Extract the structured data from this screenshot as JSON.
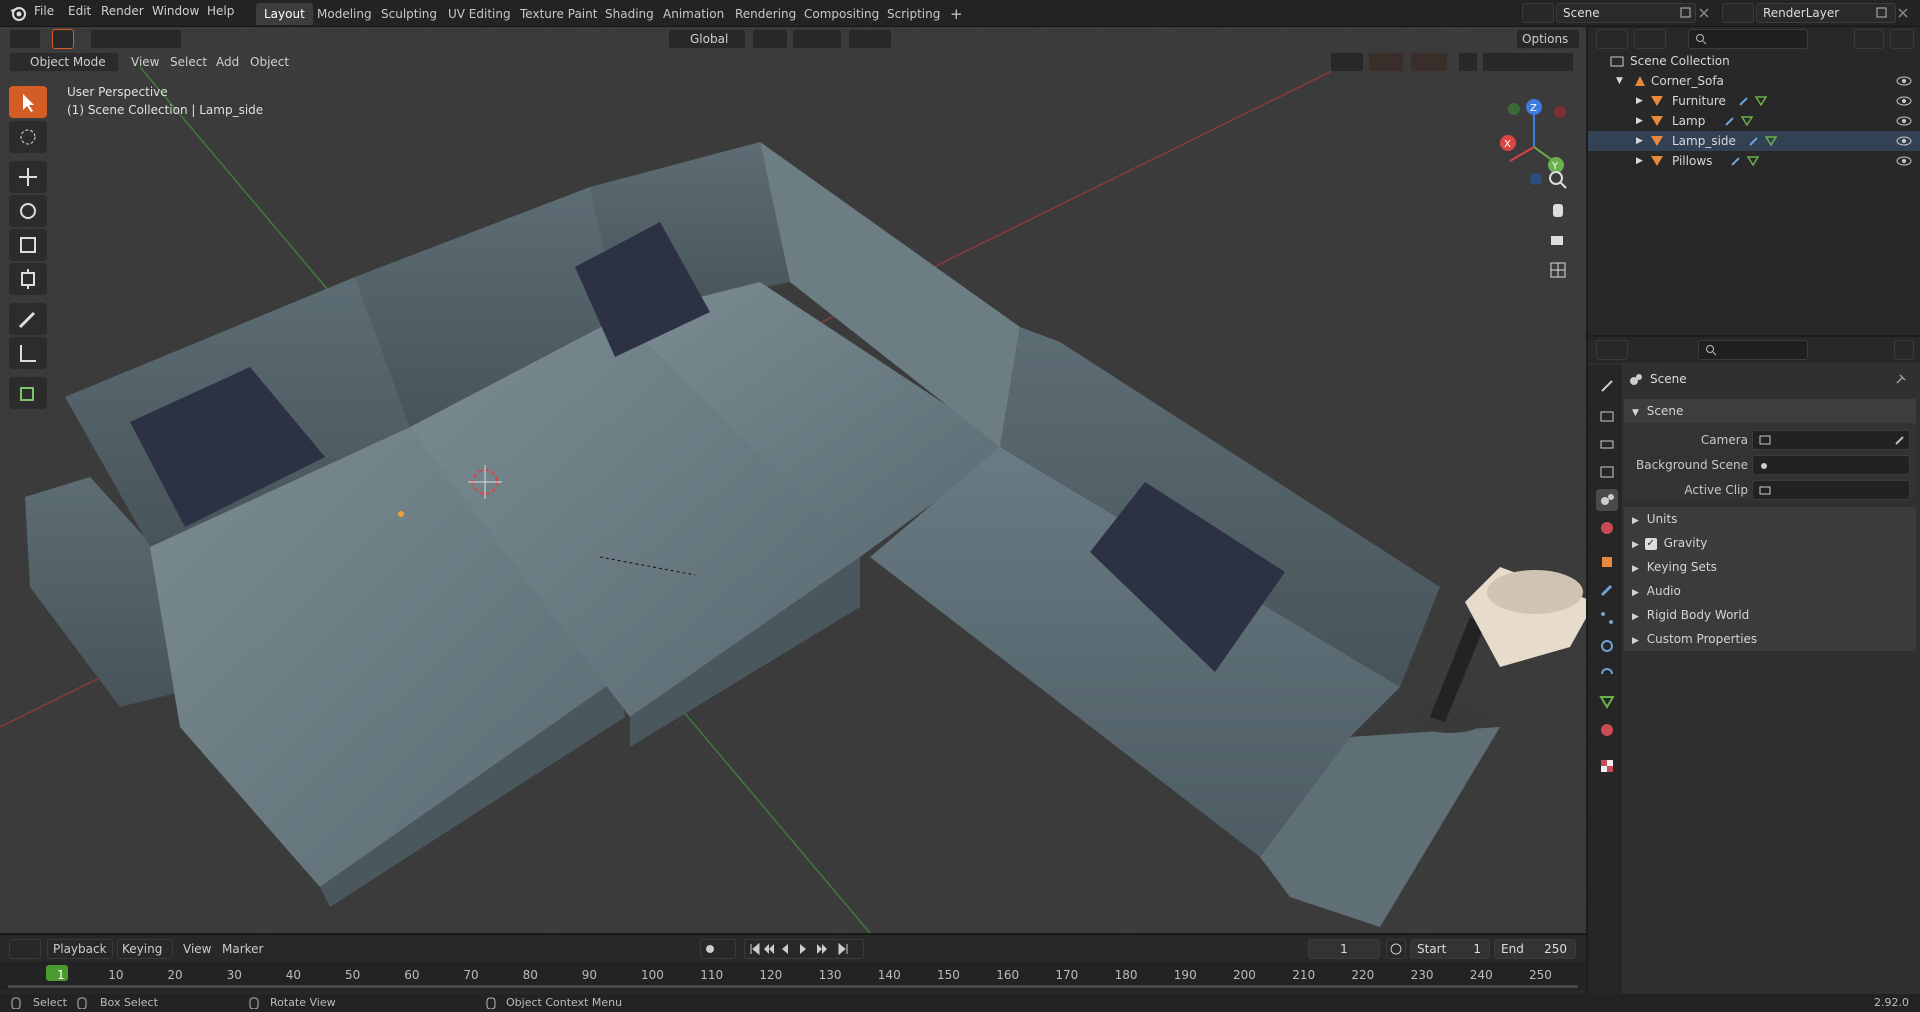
{
  "topbar": {
    "menus": [
      "File",
      "Edit",
      "Render",
      "Window",
      "Help"
    ],
    "workspaces": [
      "Layout",
      "Modeling",
      "Sculpting",
      "UV Editing",
      "Texture Paint",
      "Shading",
      "Animation",
      "Rendering",
      "Compositing",
      "Scripting"
    ],
    "active_workspace": "Layout",
    "add_tab": "+",
    "scene_name": "Scene",
    "view_layer": "RenderLayer"
  },
  "viewport": {
    "mode": "Object Mode",
    "menus": [
      "View",
      "Select",
      "Add",
      "Object"
    ],
    "transform_orientation": "Global",
    "options": "Options",
    "overlay_line1": "User Perspective",
    "overlay_line2": "(1) Scene Collection | Lamp_side",
    "axis_labels": {
      "z": "Z",
      "x": "X",
      "y": "Y"
    }
  },
  "outliner": {
    "root": "Scene Collection",
    "collection": "Corner_Sofa",
    "objects": [
      "Furniture",
      "Lamp",
      "Lamp_side",
      "Pillows"
    ]
  },
  "properties": {
    "context": "Scene",
    "panel_title": "Scene",
    "fields": [
      {
        "label": "Camera"
      },
      {
        "label": "Background Scene"
      },
      {
        "label": "Active Clip"
      }
    ],
    "subpanels": [
      "Units",
      "Gravity",
      "Keying Sets",
      "Audio",
      "Rigid Body World",
      "Custom Properties"
    ],
    "gravity_checked": true
  },
  "timeline": {
    "menus": [
      "Playback",
      "Keying",
      "View",
      "Marker"
    ],
    "current_frame": "1",
    "start_label": "Start",
    "start": "1",
    "end_label": "End",
    "end": "250",
    "ruler": [
      "1",
      "10",
      "20",
      "30",
      "40",
      "50",
      "60",
      "70",
      "80",
      "90",
      "100",
      "110",
      "120",
      "130",
      "140",
      "150",
      "160",
      "170",
      "180",
      "190",
      "200",
      "210",
      "220",
      "230",
      "240",
      "250"
    ]
  },
  "status": {
    "select": "Select",
    "box_select": "Box Select",
    "rotate_view": "Rotate View",
    "context_menu": "Object Context Menu",
    "version": "2.92.0"
  },
  "colors": {
    "accent": "#d45d26",
    "active_frame": "#4a9b2f",
    "sofa": "#6b7d85",
    "pillow": "#2d3144"
  }
}
